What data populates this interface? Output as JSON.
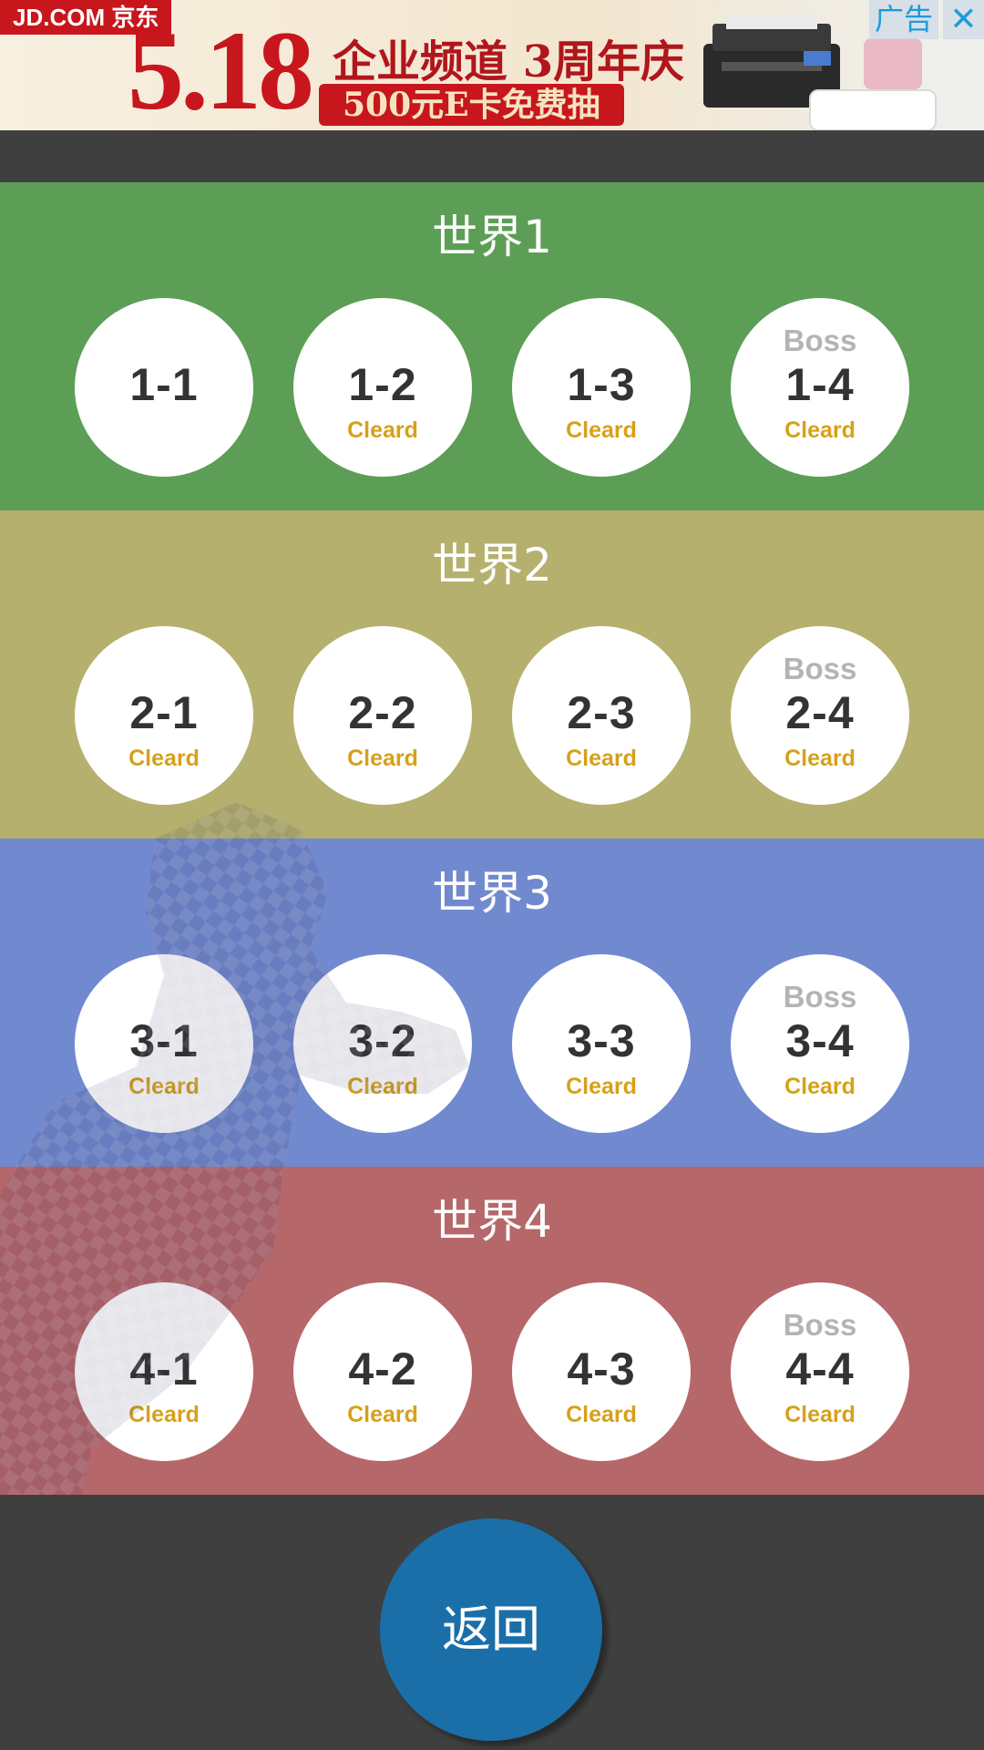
{
  "ad": {
    "brand": "JD.COM 京东",
    "big_date": "5.18",
    "headline": "企业频道 3周年庆",
    "promo": "500元E卡免费抽",
    "tag": "广告",
    "close": "✕"
  },
  "worlds": [
    {
      "title": "世界1",
      "levels": [
        {
          "label": "1-1",
          "boss": "",
          "status": ""
        },
        {
          "label": "1-2",
          "boss": "",
          "status": "Cleard"
        },
        {
          "label": "1-3",
          "boss": "",
          "status": "Cleard"
        },
        {
          "label": "1-4",
          "boss": "Boss",
          "status": "Cleard"
        }
      ]
    },
    {
      "title": "世界2",
      "levels": [
        {
          "label": "2-1",
          "boss": "",
          "status": "Cleard"
        },
        {
          "label": "2-2",
          "boss": "",
          "status": "Cleard"
        },
        {
          "label": "2-3",
          "boss": "",
          "status": "Cleard"
        },
        {
          "label": "2-4",
          "boss": "Boss",
          "status": "Cleard"
        }
      ]
    },
    {
      "title": "世界3",
      "levels": [
        {
          "label": "3-1",
          "boss": "",
          "status": "Cleard"
        },
        {
          "label": "3-2",
          "boss": "",
          "status": "Cleard"
        },
        {
          "label": "3-3",
          "boss": "",
          "status": "Cleard"
        },
        {
          "label": "3-4",
          "boss": "Boss",
          "status": "Cleard"
        }
      ]
    },
    {
      "title": "世界4",
      "levels": [
        {
          "label": "4-1",
          "boss": "",
          "status": "Cleard"
        },
        {
          "label": "4-2",
          "boss": "",
          "status": "Cleard"
        },
        {
          "label": "4-3",
          "boss": "",
          "status": "Cleard"
        },
        {
          "label": "4-4",
          "boss": "Boss",
          "status": "Cleard"
        }
      ]
    }
  ],
  "back_button": "返回",
  "colors": {
    "world1": "#5c9e55",
    "world2": "#b5b06d",
    "world3": "#7189cf",
    "world4": "#b6676a",
    "cleared": "#d6a11a",
    "back": "#1b6fa8"
  }
}
